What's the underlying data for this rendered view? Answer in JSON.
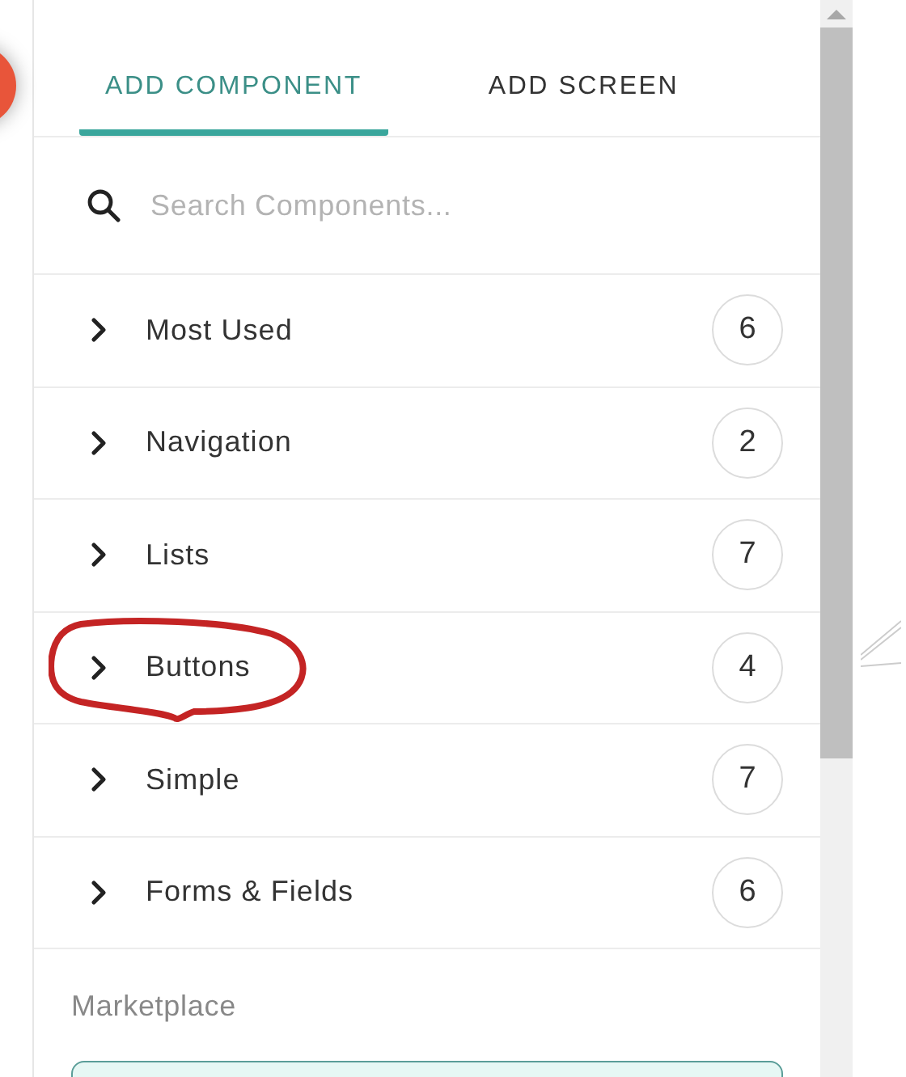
{
  "tabs": [
    {
      "label": "ADD COMPONENT",
      "selected": true
    },
    {
      "label": "ADD SCREEN",
      "selected": false
    }
  ],
  "search": {
    "placeholder": "Search Components..."
  },
  "categories": [
    {
      "label": "Most Used",
      "count": "6",
      "expanded": false
    },
    {
      "label": "Navigation",
      "count": "2",
      "expanded": false
    },
    {
      "label": "Lists",
      "count": "7",
      "expanded": false
    },
    {
      "label": "Buttons",
      "count": "4",
      "expanded": false
    },
    {
      "label": "Simple",
      "count": "7",
      "expanded": false
    },
    {
      "label": "Forms & Fields",
      "count": "6",
      "expanded": false
    }
  ],
  "marketplace": {
    "heading": "Marketplace"
  }
}
